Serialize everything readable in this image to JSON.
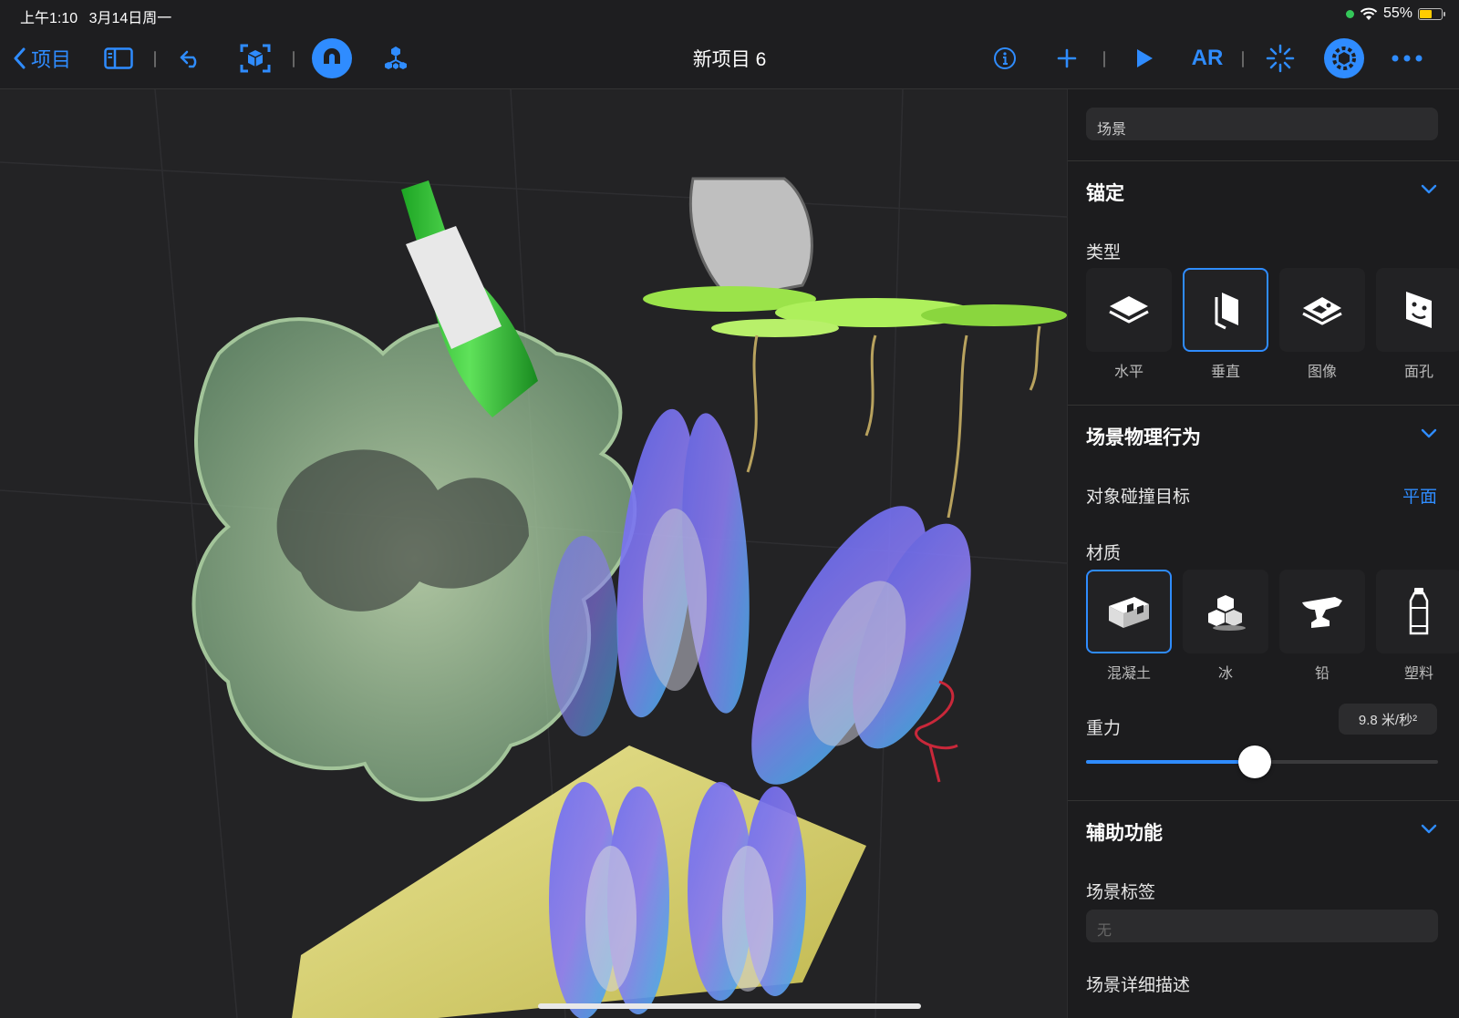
{
  "status": {
    "time": "上午1:10",
    "date": "3月14日周一",
    "battery": "55%",
    "battery_level": 0.55
  },
  "toolbar": {
    "back_label": "项目",
    "title": "新项目 6",
    "ar_label": "AR",
    "icons": [
      "chevron-left-icon",
      "sidebar-icon",
      "undo-icon",
      "scene-frame-icon",
      "magnet-icon",
      "anchor-tree-icon",
      "info-icon",
      "plus-icon",
      "play-icon",
      "ar-label",
      "spark-icon",
      "inspector-gear-icon",
      "more-icon"
    ]
  },
  "panel": {
    "scene_field": "场景",
    "anchor": {
      "title": "锚定",
      "type_label": "类型",
      "types": [
        {
          "label": "水平",
          "icon": "horizontal-plane-icon",
          "selected": false
        },
        {
          "label": "垂直",
          "icon": "vertical-plane-icon",
          "selected": true
        },
        {
          "label": "图像",
          "icon": "image-anchor-icon",
          "selected": false
        },
        {
          "label": "面孔",
          "icon": "face-anchor-icon",
          "selected": false
        }
      ]
    },
    "physics": {
      "title": "场景物理行为",
      "collision_label": "对象碰撞目标",
      "collision_value": "平面",
      "material_label": "材质",
      "materials": [
        {
          "label": "混凝土",
          "icon": "concrete-block-icon",
          "selected": true
        },
        {
          "label": "冰",
          "icon": "ice-cubes-icon",
          "selected": false
        },
        {
          "label": "铅",
          "icon": "anvil-icon",
          "selected": false
        },
        {
          "label": "塑料",
          "icon": "plastic-bottle-icon",
          "selected": false
        }
      ],
      "gravity_label": "重力",
      "gravity_value": "9.8 米/秒²",
      "gravity_fraction": 0.48
    },
    "accessibility": {
      "title": "辅助功能",
      "scene_tag_label": "场景标签",
      "scene_tag_placeholder": "无",
      "scene_description_label": "场景详细描述"
    }
  },
  "colors": {
    "accent": "#2f8cff",
    "background": "#1c1c1e",
    "viewport": "#232325"
  }
}
